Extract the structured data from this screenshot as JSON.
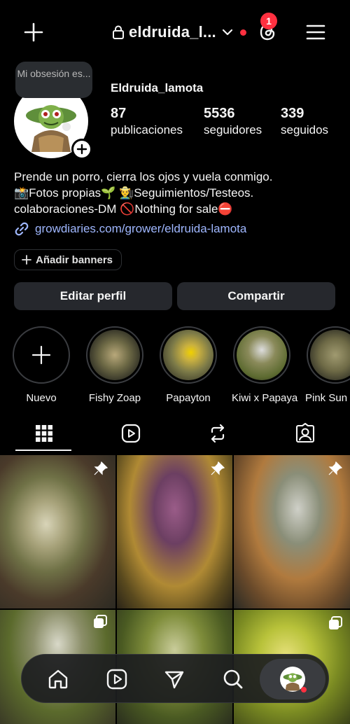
{
  "header": {
    "username": "eldruida_l...",
    "notification_count": "1"
  },
  "profile": {
    "note": "Mi obsesión es...",
    "display_name": "Eldruida_lamota",
    "stats": [
      {
        "value": "87",
        "label": "publicaciones"
      },
      {
        "value": "5536",
        "label": "seguidores"
      },
      {
        "value": "339",
        "label": "seguidos"
      }
    ],
    "bio_lines": [
      "Prende un porro, cierra los ojos y vuela conmigo.",
      "📸Fotos propias🌱 👨‍🌾Seguimientos/Testeos.",
      "colaboraciones-DM 🚫Nothing for sale⛔"
    ],
    "link": "growdiaries.com/grower/eldruida-lamota",
    "banners_label": "Añadir banners"
  },
  "actions": {
    "edit_label": "Editar perfil",
    "share_label": "Compartir"
  },
  "highlights": [
    {
      "label": "Nuevo"
    },
    {
      "label": "Fishy Zoap"
    },
    {
      "label": "Papayton"
    },
    {
      "label": "Kiwi x Papaya"
    },
    {
      "label": "Pink Sun"
    }
  ],
  "tabs": [
    "grid-icon",
    "reels-icon",
    "reposts-icon",
    "tagged-icon"
  ],
  "colors": {
    "background": "#000000",
    "button": "#26282d",
    "link": "#9fb7ff",
    "badge": "#ff3040"
  }
}
